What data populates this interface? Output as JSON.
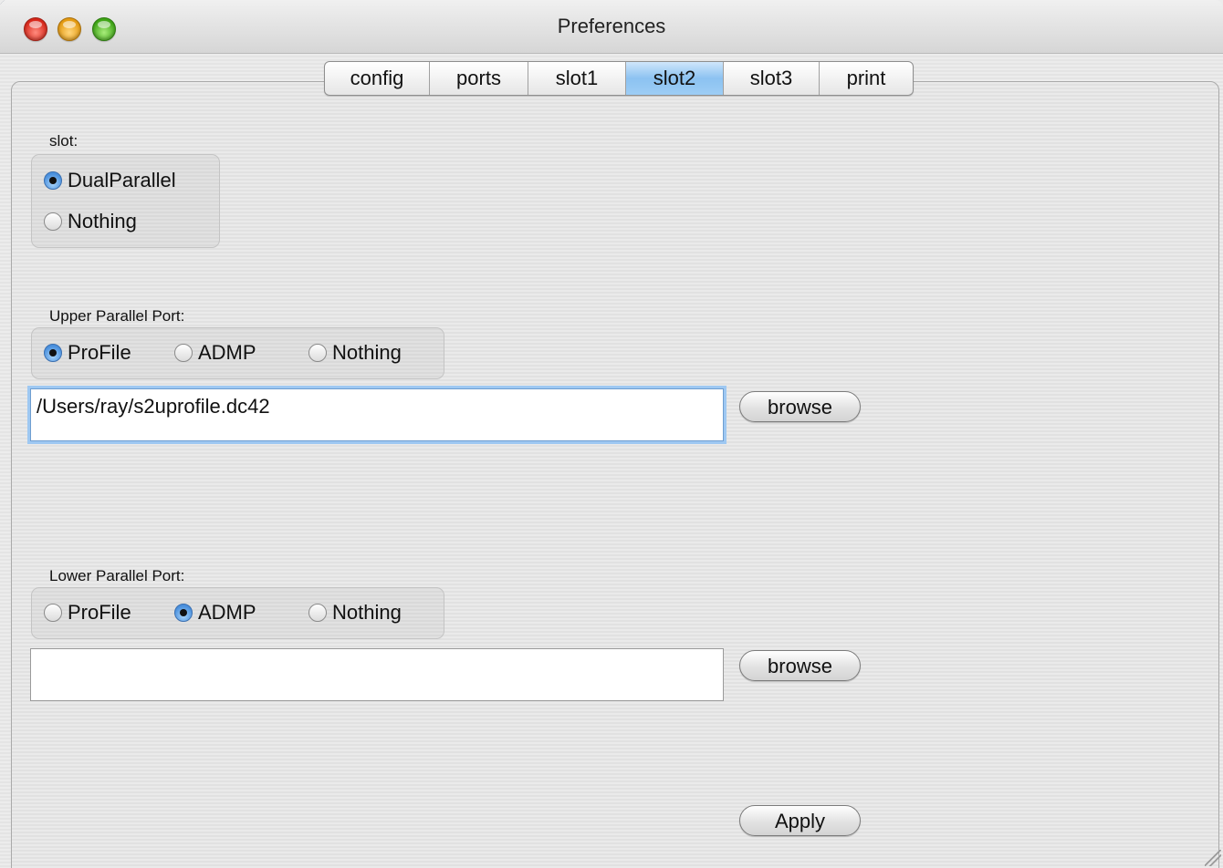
{
  "window": {
    "title": "Preferences"
  },
  "tabs": [
    {
      "label": "config"
    },
    {
      "label": "ports"
    },
    {
      "label": "slot1"
    },
    {
      "label": "slot2"
    },
    {
      "label": "slot3"
    },
    {
      "label": "print"
    }
  ],
  "active_tab": "slot2",
  "slot_group": {
    "label": "slot:",
    "options": [
      "DualParallel",
      "Nothing"
    ],
    "selected": "DualParallel"
  },
  "upper_port": {
    "label": "Upper Parallel Port:",
    "options": [
      "ProFile",
      "ADMP",
      "Nothing"
    ],
    "selected": "ProFile",
    "path_value": "/Users/ray/s2uprofile.dc42",
    "browse_label": "browse"
  },
  "lower_port": {
    "label": "Lower Parallel Port:",
    "options": [
      "ProFile",
      "ADMP",
      "Nothing"
    ],
    "selected": "ADMP",
    "path_value": "",
    "browse_label": "browse"
  },
  "apply_label": "Apply",
  "colors": {
    "tab_active": "#8cc2f1",
    "focus_ring": "#9ec8f2",
    "close_button": "#d8271a",
    "minimize_button": "#e59b12",
    "maximize_button": "#3ea516"
  }
}
